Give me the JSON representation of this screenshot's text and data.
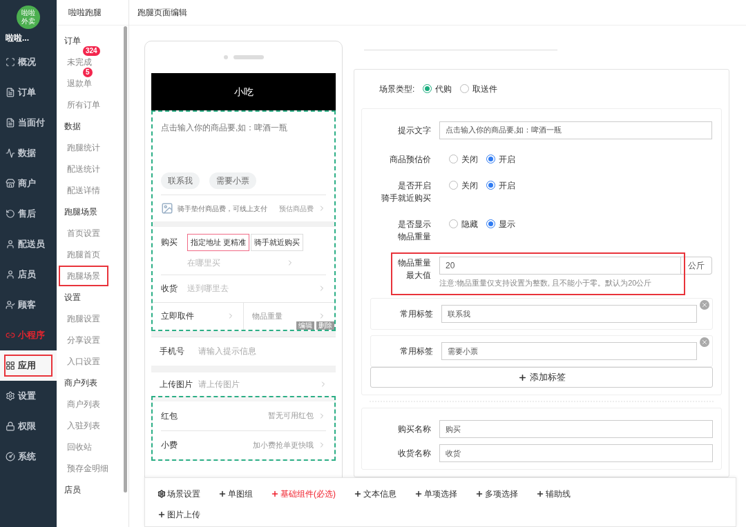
{
  "sidebar": {
    "logo": [
      "啦啦",
      "外卖"
    ],
    "name": "啦啦...",
    "items": [
      {
        "label": "概况",
        "selected": false,
        "highlighted": false,
        "color": "#c3c9d1"
      },
      {
        "label": "订单",
        "selected": false,
        "highlighted": false,
        "color": "#c3c9d1"
      },
      {
        "label": "当面付",
        "selected": false,
        "highlighted": false,
        "color": "#c3c9d1"
      },
      {
        "label": "数据",
        "selected": false,
        "highlighted": false,
        "color": "#c3c9d1"
      },
      {
        "label": "商户",
        "selected": false,
        "highlighted": false,
        "color": "#c3c9d1"
      },
      {
        "label": "售后",
        "selected": false,
        "highlighted": false,
        "color": "#c3c9d1"
      },
      {
        "label": "配送员",
        "selected": false,
        "highlighted": false,
        "color": "#c3c9d1"
      },
      {
        "label": "店员",
        "selected": false,
        "highlighted": false,
        "color": "#c3c9d1"
      },
      {
        "label": "顾客",
        "selected": false,
        "highlighted": false,
        "color": "#c3c9d1"
      },
      {
        "label": "小程序",
        "selected": false,
        "highlighted": false,
        "color": "#e0252f"
      },
      {
        "label": "应用",
        "selected": true,
        "highlighted": true,
        "color": "#333333"
      },
      {
        "label": "设置",
        "selected": false,
        "highlighted": false,
        "color": "#c3c9d1"
      },
      {
        "label": "权限",
        "selected": false,
        "highlighted": false,
        "color": "#c3c9d1"
      },
      {
        "label": "系统",
        "selected": false,
        "highlighted": false,
        "color": "#c3c9d1"
      }
    ]
  },
  "submenu": {
    "title": "啦啦跑腿",
    "groups": [
      {
        "title": "订单",
        "items": [
          {
            "label": "未完成",
            "badge": "324",
            "highlighted": false
          },
          {
            "label": "退款单",
            "badge": "5",
            "highlighted": false
          },
          {
            "label": "所有订单",
            "highlighted": false
          }
        ]
      },
      {
        "title": "数据",
        "items": [
          {
            "label": "跑腿统计",
            "highlighted": false
          },
          {
            "label": "配送统计",
            "highlighted": false
          },
          {
            "label": "配送详情",
            "highlighted": false
          }
        ]
      },
      {
        "title": "跑腿场景",
        "items": [
          {
            "label": "首页设置",
            "highlighted": false
          },
          {
            "label": "跑腿首页",
            "highlighted": false
          },
          {
            "label": "跑腿场景",
            "highlighted": true
          }
        ]
      },
      {
        "title": "设置",
        "items": [
          {
            "label": "跑腿设置",
            "highlighted": false
          },
          {
            "label": "分享设置",
            "highlighted": false
          },
          {
            "label": "入口设置",
            "highlighted": false
          }
        ]
      },
      {
        "title": "商户列表",
        "items": [
          {
            "label": "商户列表",
            "highlighted": false
          },
          {
            "label": "入驻列表",
            "highlighted": false
          },
          {
            "label": "回收站",
            "highlighted": false
          },
          {
            "label": "预存金明细",
            "highlighted": false
          }
        ]
      },
      {
        "title": "店员"
      }
    ]
  },
  "page_title": "跑腿页面编辑",
  "phone": {
    "title": "小吃",
    "placeholder": "点击输入你的商品要,如：啤酒一瓶",
    "tags": [
      "联系我",
      "需要小票"
    ],
    "advance": {
      "text": "骑手垫付商品费，可线上支付",
      "link": "预估商品费"
    },
    "buy": {
      "label": "购买",
      "options": [
        {
          "label": "指定地址 更精准",
          "selected": true
        },
        {
          "label": "骑手就近购买",
          "selected": false
        }
      ],
      "placeholder": "在哪里买"
    },
    "receive": {
      "label": "收货",
      "placeholder": "送到哪里去"
    },
    "pickup": "立即取件",
    "weight": "物品重量",
    "block_actions": [
      "编辑",
      "删除"
    ],
    "phone_row": {
      "label": "手机号",
      "placeholder": "请输入提示信息"
    },
    "upload": {
      "label": "上传图片",
      "placeholder": "请上传图片"
    },
    "extras": [
      {
        "label": "红包",
        "value": "暂无可用红包"
      },
      {
        "label": "小费",
        "value": "加小费抢单更快哦"
      }
    ]
  },
  "settings": {
    "scene_type": {
      "label": "场景类型:",
      "options": [
        {
          "label": "代购",
          "selected": true
        },
        {
          "label": "取送件",
          "selected": false
        }
      ]
    },
    "fields": [
      {
        "kind": "text",
        "label": [
          "提示文字"
        ],
        "value": "点击输入你的商品要,如：啤酒一瓶"
      },
      {
        "kind": "radio",
        "label": [
          "商品预估价"
        ],
        "options": [
          {
            "label": "关闭",
            "selected": false
          },
          {
            "label": "开启",
            "selected": true
          }
        ]
      },
      {
        "kind": "radio",
        "label": [
          "是否开启",
          "骑手就近购买"
        ],
        "options": [
          {
            "label": "关闭",
            "selected": false
          },
          {
            "label": "开启",
            "selected": true
          }
        ]
      },
      {
        "kind": "radio",
        "label": [
          "是否显示",
          "物品重量"
        ],
        "options": [
          {
            "label": "隐藏",
            "selected": false
          },
          {
            "label": "显示",
            "selected": true
          }
        ]
      },
      {
        "kind": "unit",
        "label": [
          "物品重量",
          "最大值"
        ],
        "value": "20",
        "unit": "公斤",
        "note": "注意:物品重量仅支持设置为整数, 且不能小于零。默认为20公斤",
        "highlighted": true
      }
    ],
    "tags": [
      {
        "label": "常用标签",
        "value": "联系我"
      },
      {
        "label": "常用标签",
        "value": "需要小票"
      }
    ],
    "add_tag": "添加标签",
    "names": [
      {
        "label": "购买名称",
        "value": "购买"
      },
      {
        "label": "收货名称",
        "value": "收货"
      }
    ]
  },
  "toolbar": [
    {
      "kind": "settings",
      "label": "场景设置"
    },
    {
      "kind": "add",
      "label": "单图组"
    },
    {
      "kind": "required",
      "label": "基础组件(必选)"
    },
    {
      "kind": "add",
      "label": "文本信息"
    },
    {
      "kind": "add",
      "label": "单项选择"
    },
    {
      "kind": "add",
      "label": "多项选择"
    },
    {
      "kind": "add",
      "label": "辅助线"
    },
    {
      "kind": "add",
      "label": "图片上传"
    }
  ]
}
